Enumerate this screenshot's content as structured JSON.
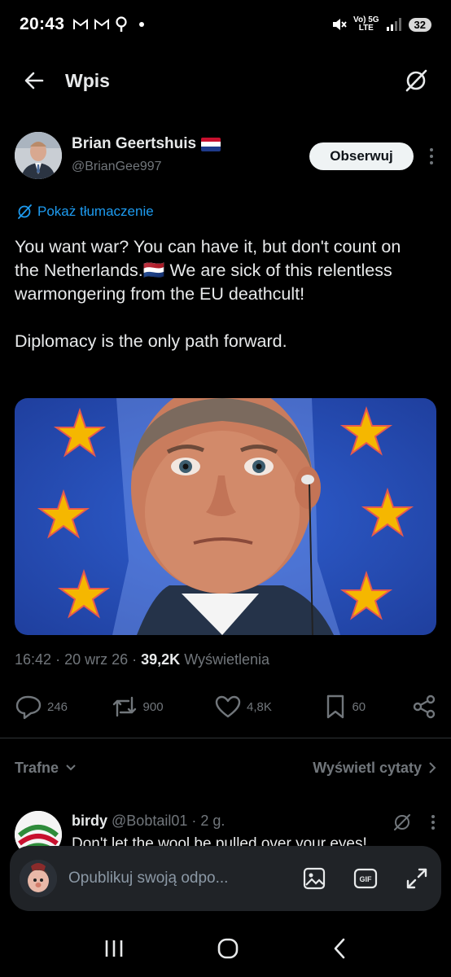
{
  "status": {
    "time": "20:43",
    "network_top": "Vo) 5G",
    "network_bottom": "LTE",
    "battery": "32"
  },
  "header": {
    "title": "Wpis"
  },
  "tweet": {
    "author_name": "Brian Geertshuis",
    "author_flag": "🇳🇱",
    "author_handle": "@BrianGee997",
    "follow_label": "Obserwuj",
    "translate_label": "Pokaż tłumaczenie",
    "text": "You want war? You can have it, but don't count on the Netherlands.🇳🇱 We are sick of this relentless warmongering from the EU deathcult!\n\nDiplomacy is the only path forward.",
    "time": "16:42",
    "date": "20 wrz 26",
    "views_count": "39,2K",
    "views_label": "Wyświetlenia",
    "replies": "246",
    "reposts": "900",
    "likes": "4,8K",
    "bookmarks": "60"
  },
  "sort": {
    "left_label": "Trafne",
    "right_label": "Wyświetl cytaty"
  },
  "reply": {
    "name": "birdy",
    "handle": "@Bobtail01",
    "age": "· 2 g.",
    "text": "Don't let the wool be pulled over your eyes!"
  },
  "composer": {
    "placeholder": "Opublikuj swoją odpo..."
  },
  "colors": {
    "background": "#000000",
    "accent": "#1d9bf0",
    "muted": "#71767b",
    "text": "#e7e9ea"
  }
}
